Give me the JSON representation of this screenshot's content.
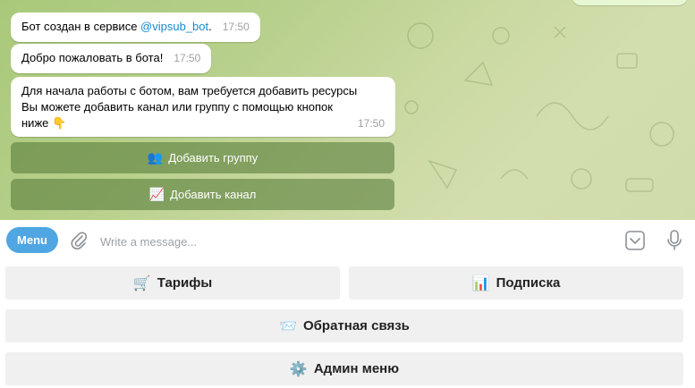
{
  "messages": [
    {
      "text_before": "Бот создан в сервисе ",
      "mention": "@vipsub_bot",
      "text_after": ".",
      "time": "17:50"
    },
    {
      "text": "Добро пожаловать в бота!",
      "time": "17:50"
    },
    {
      "line1": "Для начала работы с ботом, вам требуется добавить ресурсы",
      "line2": "Вы можете добавить канал или группу с помощью кнопок",
      "line3": "ниже",
      "emoji": "👇",
      "time": "17:50"
    }
  ],
  "inline_buttons": [
    {
      "emoji": "👥",
      "label": "Добавить группу"
    },
    {
      "emoji": "📈",
      "label": "Добавить канал"
    }
  ],
  "composer": {
    "menu_label": "Menu",
    "placeholder": "Write a message..."
  },
  "reply_keyboard": [
    {
      "emoji": "🛒",
      "label": "Тарифы"
    },
    {
      "emoji": "📊",
      "label": "Подписка"
    },
    {
      "emoji": "📨",
      "label": "Обратная связь"
    },
    {
      "emoji": "⚙️",
      "label": "Админ меню"
    }
  ],
  "colors": {
    "accent": "#4fa6e3",
    "mention": "#168acd",
    "inline_button_bg": "rgba(86,122,56,0.58)",
    "reply_button_bg": "#f0f0f0"
  }
}
